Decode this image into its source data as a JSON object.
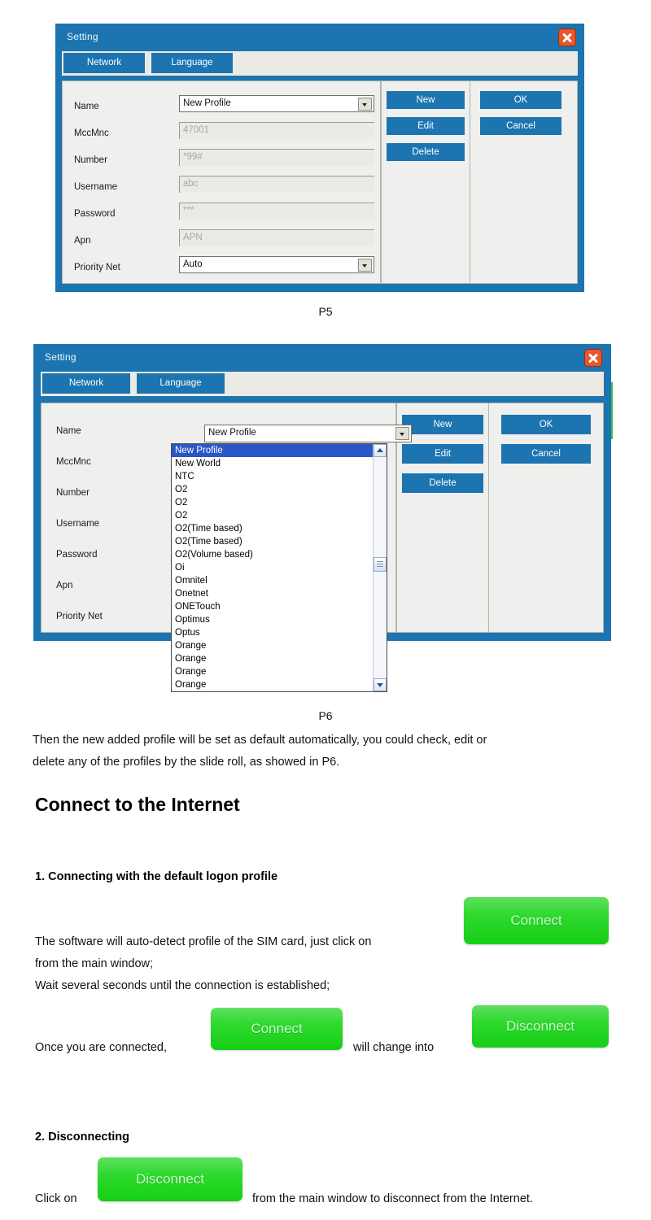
{
  "dialogs": {
    "p5": {
      "title": "Setting",
      "close_icon": "close-icon",
      "tabs": [
        {
          "label": "Network"
        },
        {
          "label": "Language"
        }
      ],
      "fields": [
        {
          "label": "Name",
          "value": "New Profile",
          "type": "combo"
        },
        {
          "label": "MccMnc",
          "value": "47001",
          "type": "text"
        },
        {
          "label": "Number",
          "value": "*99#",
          "type": "text"
        },
        {
          "label": "Username",
          "value": "abc",
          "type": "text"
        },
        {
          "label": "Password",
          "value": "***",
          "type": "text"
        },
        {
          "label": "Apn",
          "value": "APN",
          "type": "text"
        },
        {
          "label": "Priority Net",
          "value": "Auto",
          "type": "combo"
        }
      ],
      "action_buttons": [
        {
          "label": "New"
        },
        {
          "label": "Edit"
        },
        {
          "label": "Delete"
        }
      ],
      "confirm_buttons": [
        {
          "label": "OK"
        },
        {
          "label": "Cancel"
        }
      ],
      "caption": "P5"
    },
    "p6": {
      "title": "Setting",
      "close_icon": "close-icon",
      "tabs": [
        {
          "label": "Network"
        },
        {
          "label": "Language"
        }
      ],
      "fields": [
        {
          "label": "Name"
        },
        {
          "label": "MccMnc"
        },
        {
          "label": "Number"
        },
        {
          "label": "Username"
        },
        {
          "label": "Password"
        },
        {
          "label": "Apn"
        },
        {
          "label": "Priority Net"
        }
      ],
      "combo_value": "New Profile",
      "dropdown": {
        "selected": "New Profile",
        "items": [
          "New Profile",
          "New World",
          "NTC",
          "O2",
          "O2",
          "O2",
          "O2(Time based)",
          "O2(Time based)",
          "O2(Volume based)",
          "Oi",
          "Omnitel",
          "Onetnet",
          "ONETouch",
          "Optimus",
          "Optus",
          "Orange",
          "Orange",
          "Orange",
          "Orange"
        ],
        "scroll_up_icon": "chevron-up-icon",
        "scroll_down_icon": "chevron-down-icon"
      },
      "action_buttons": [
        {
          "label": "New"
        },
        {
          "label": "Edit"
        },
        {
          "label": "Delete"
        }
      ],
      "confirm_buttons": [
        {
          "label": "OK"
        },
        {
          "label": "Cancel"
        }
      ],
      "caption": "P6"
    }
  },
  "body": {
    "p6_note_line1": "Then the new added profile will be set as default automatically, you could check, edit or",
    "p6_note_line2": "delete any of the profiles by the slide roll, as showed in P6.",
    "heading": "Connect to the Internet",
    "section1": {
      "heading": "1. Connecting with the default logon profile",
      "line1": "The software will auto-detect profile of the SIM card, just click on",
      "line2": "from the main window;",
      "line3": "Wait several seconds until the connection is established;",
      "line4_before": "Once you are connected,",
      "line4_middle": "will change into",
      "connect_label": "Connect",
      "disconnect_label": "Disconnect"
    },
    "section2": {
      "heading": "2. Disconnecting",
      "line_before": "Click on",
      "line_after": "from the main window to disconnect from the Internet.",
      "disconnect_label": "Disconnect"
    }
  },
  "colors": {
    "title_blue": "#1c74b0",
    "panel_gray": "#efefed",
    "green": "#2fd92f",
    "close_red": "#e8562a",
    "select_blue": "#2a56c6"
  }
}
